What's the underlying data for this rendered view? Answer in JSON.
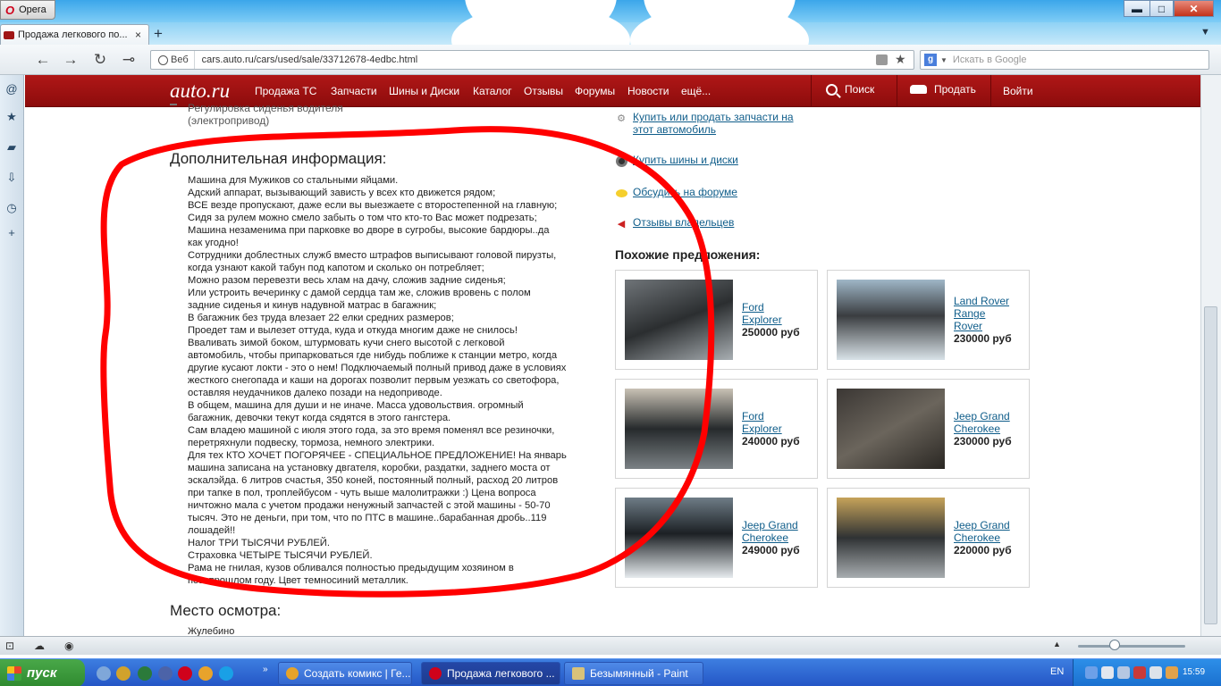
{
  "browser": {
    "menu_label": "Opera",
    "window_buttons": {
      "minimize": "▬",
      "maximize": "□",
      "close": "✕"
    },
    "tab": {
      "title": "Продажа легкового по...",
      "close": "×"
    },
    "new_tab": "+",
    "tab_list": "▼",
    "nav": {
      "back": "←",
      "forward": "→",
      "reload": "↻",
      "key": "⊸"
    },
    "address": {
      "scheme_label": "Веб",
      "url": "cars.auto.ru/cars/used/sale/33712678-4edbc.html"
    },
    "search": {
      "engine": "g",
      "placeholder": "Искать в Google"
    },
    "panel_icons": [
      "opera-mail-icon",
      "bookmarks-star-icon",
      "notes-icon",
      "downloads-icon",
      "history-clock-icon",
      "add-panel-icon"
    ]
  },
  "site": {
    "logo": "auto.ru",
    "nav": [
      "Продажа ТС",
      "Запчасти",
      "Шины и Диски",
      "Каталог",
      "Отзывы",
      "Форумы",
      "Новости",
      "ещё..."
    ],
    "search": "Поиск",
    "sell": "Продать",
    "login": "Войти"
  },
  "listing": {
    "seat_option": "Регулировка сиденья водителя\n(электропривод)",
    "additional_title": "Дополнительная информация:",
    "description": "Машина для Мужиков со стальными яйцами.\nАдский аппарат, вызывающий зависть у всех кто движется рядом;\nВСЕ везде пропускают, даже если вы выезжаете с второстепенной на главную;\nСидя за рулем можно смело забыть о том что кто-то Вас может подрезать;\nМашина незаменима при парковке во дворе в сугробы, высокие бардюры..да\nкак угодно!\nСотрудники доблестных служб вместо штрафов выписывают головой пирузты,\nкогда узнают какой табун под капотом и сколько он потребляет;\nМожно разом перевезти весь хлам на дачу, сложив задние сиденья;\nИли устроить вечеринку с дамой сердца там же, сложив вровень с полом\nзадние сиденья и кинув надувной матрас в багажник;\nВ багажник без труда влезает 22 елки средних размеров;\nПроедет там и вылезет оттуда, куда и откуда многим даже не снилось!\nВваливать зимой боком, штурмовать кучи снего высотой с легковой\nавтомобиль, чтобы припарковаться где нибудь поближе к станции метро, когда\nдругие кусают локти - это о нем! Подключаемый полный привод даже в условиях\nжесткого снегопада и каши на дорогах позволит первым уезжать со светофора,\nоставляя неудачников далеко позади на недоприводе.\nВ общем, машина для души и не иначе. Масса удовольствия. огромный\nбагажник, девочки текут когда сядятся в этого гангстера.\nСам владею машиной с июля этого года, за это время поменял все резиночки,\nперетряхнули подвеску, тормоза, немного электрики.\nДля тех КТО ХОЧЕТ ПОГОРЯЧЕЕ - СПЕЦИАЛЬНОЕ ПРЕДЛОЖЕНИЕ! На январь\nмашина записана на установку двгателя, коробки, раздатки, заднего моста от\nэскалэйда. 6 литров счастья, 350 коней, постоянный полный, расход 20 литров\nпри тапке в пол, троплейбусом - чуть выше малолитражки :) Цена вопроса\nничтожно мала с учетом продажи ненужный запчастей с этой машины - 50-70\nтысяч. Это не деньги, при том, что по ПТС в машине..барабанная дробь..119\nлошадей!!\nНалог ТРИ ТЫСЯЧИ РУБЛЕЙ.\nСтраховка ЧЕТЫРЕ ТЫСЯЧИ РУБЛЕЙ.\nРама не гнилая, кузов обливался полностью предыдущим хозяином в\nпозапрошлом году. Цвет темносиний металлик.",
    "inspection_title": "Место осмотра:",
    "inspection_place": "Жулебино"
  },
  "sidebar": {
    "links": [
      {
        "icon": "gear-icon",
        "text": "Купить или продать запчасти на\nэтот автомобиль"
      },
      {
        "icon": "tire-icon",
        "text": "Купить шины и диски"
      },
      {
        "icon": "speech-bubble-icon",
        "text": "Обсудить на форуме"
      },
      {
        "icon": "megaphone-icon",
        "text": "Отзывы владельцев"
      }
    ],
    "similar_title": "Похожие предложения:",
    "similar": [
      {
        "title": "Ford\nExplorer",
        "price": "250000 руб"
      },
      {
        "title": "Land Rover\nRange\nRover",
        "price": "230000 руб"
      },
      {
        "title": "Ford\nExplorer",
        "price": "240000 руб"
      },
      {
        "title": "Jeep Grand\nCherokee",
        "price": "230000 руб"
      },
      {
        "title": "Jeep Grand\nCherokee",
        "price": "249000 руб"
      },
      {
        "title": "Jeep Grand\nCherokee",
        "price": "220000 руб"
      }
    ]
  },
  "colors": {
    "brand_red": "#a81313",
    "annotation_red": "#ff0000",
    "link": "#0f5d8a"
  },
  "taskbar": {
    "start": "пуск",
    "tasks": [
      "Создать комикс | Ге...",
      "Продажа легкового ...",
      "Безымянный - Paint"
    ],
    "language": "EN",
    "clock": "15:59"
  }
}
